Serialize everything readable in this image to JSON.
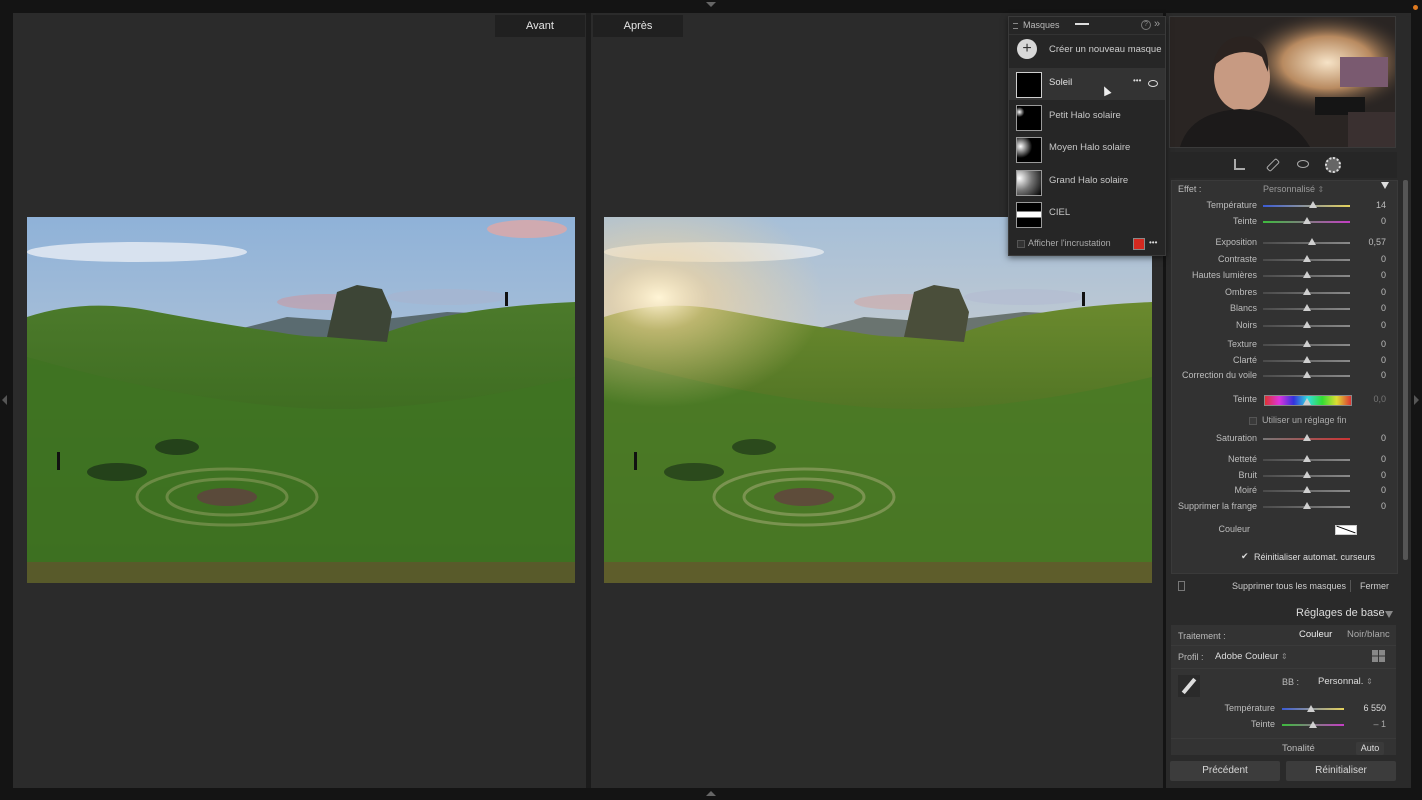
{
  "compare": {
    "before_label": "Avant",
    "after_label": "Après"
  },
  "masks_panel": {
    "title": "Masques",
    "create_label": "Créer un nouveau masque",
    "items": [
      {
        "name": "Soleil"
      },
      {
        "name": "Petit Halo solaire"
      },
      {
        "name": "Moyen Halo solaire"
      },
      {
        "name": "Grand Halo solaire"
      },
      {
        "name": "CIEL"
      }
    ],
    "overlay_label": "Afficher l'incrustation",
    "overlay_color": "#d4291f",
    "more_glyph": "•••",
    "help_glyph": "?",
    "collapse_glyph": "»"
  },
  "mask_settings": {
    "effect_label": "Effet :",
    "effect_value": "Personnalisé",
    "sliders_a": [
      {
        "label": "Température",
        "value": "14",
        "pos": 0.57,
        "track": "temp"
      },
      {
        "label": "Teinte",
        "value": "0",
        "pos": 0.5,
        "track": "tint"
      }
    ],
    "sliders_b": [
      {
        "label": "Exposition",
        "value": "0,57",
        "pos": 0.56,
        "track": "gray"
      },
      {
        "label": "Contraste",
        "value": "0",
        "pos": 0.5,
        "track": "gray"
      },
      {
        "label": "Hautes lumières",
        "value": "0",
        "pos": 0.5,
        "track": "gray"
      },
      {
        "label": "Ombres",
        "value": "0",
        "pos": 0.5,
        "track": "gray"
      },
      {
        "label": "Blancs",
        "value": "0",
        "pos": 0.5,
        "track": "gray"
      },
      {
        "label": "Noirs",
        "value": "0",
        "pos": 0.5,
        "track": "gray"
      }
    ],
    "sliders_c": [
      {
        "label": "Texture",
        "value": "0",
        "pos": 0.5,
        "track": "gray"
      },
      {
        "label": "Clarté",
        "value": "0",
        "pos": 0.5,
        "track": "gray"
      },
      {
        "label": "Correction du voile",
        "value": "0",
        "pos": 0.5,
        "track": "gray"
      }
    ],
    "hue_label": "Teinte",
    "hue_value": "0,0",
    "fine_adjust_label": "Utiliser un réglage fin",
    "saturation": {
      "label": "Saturation",
      "value": "0",
      "pos": 0.5
    },
    "sliders_d": [
      {
        "label": "Netteté",
        "value": "0",
        "pos": 0.5
      },
      {
        "label": "Bruit",
        "value": "0",
        "pos": 0.5
      },
      {
        "label": "Moiré",
        "value": "0",
        "pos": 0.5
      },
      {
        "label": "Supprimer la frange",
        "value": "0",
        "pos": 0.5
      }
    ],
    "color_label": "Couleur",
    "auto_reset_label": "Réinitialiser automat. curseurs",
    "delete_all_label": "Supprimer tous les masques",
    "close_label": "Fermer"
  },
  "basic": {
    "section_title": "Réglages de base",
    "treatment_label": "Traitement :",
    "treatment_color": "Couleur",
    "treatment_bw": "Noir/blanc",
    "profile_label": "Profil :",
    "profile_value": "Adobe Couleur",
    "wb_label": "BB :",
    "wb_value": "Personnal.",
    "temp": {
      "label": "Température",
      "value": "6 550",
      "pos": 0.5
    },
    "tint": {
      "label": "Teinte",
      "value": "– 1",
      "pos": 0.5
    },
    "tonality_label": "Tonalité",
    "auto_label": "Auto",
    "prev_button": "Précédent",
    "reset_button": "Réinitialiser"
  }
}
